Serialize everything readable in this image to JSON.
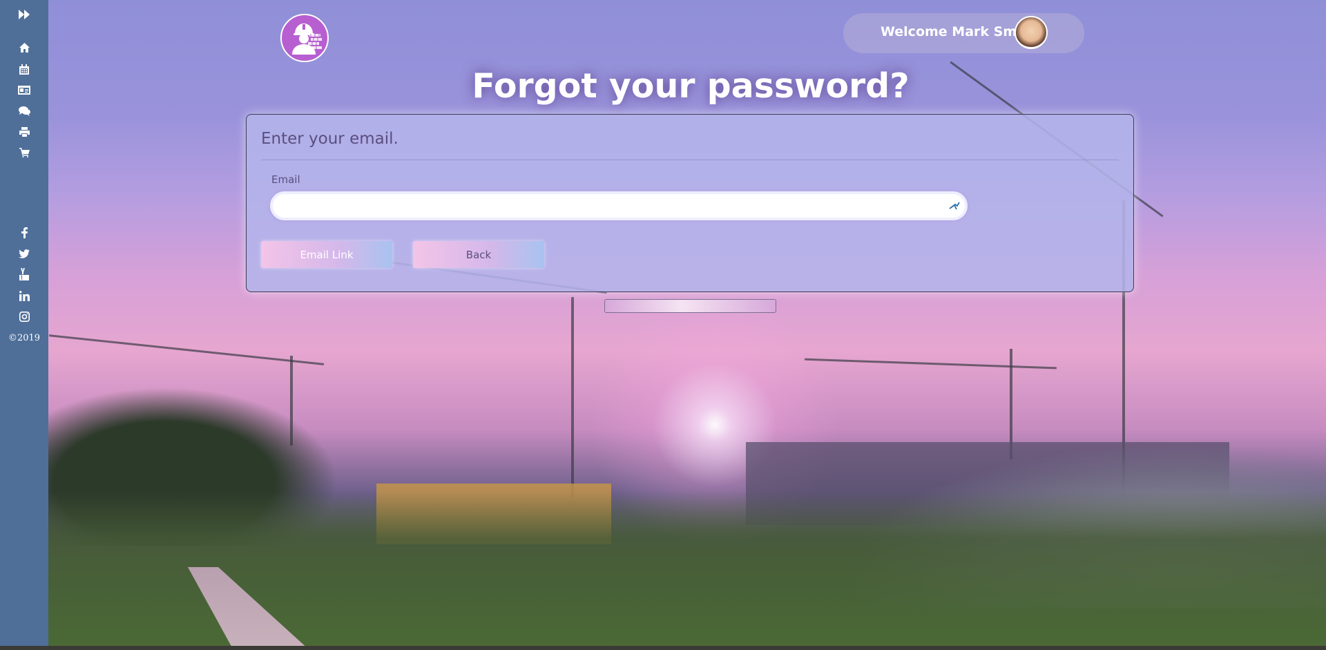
{
  "sidebar": {
    "items": [
      {
        "icon": "fast-forward-icon",
        "name": "expand"
      },
      {
        "icon": "home-icon",
        "name": "home"
      },
      {
        "icon": "calendar-icon",
        "name": "calendar"
      },
      {
        "icon": "id-card-icon",
        "name": "id-card"
      },
      {
        "icon": "comments-icon",
        "name": "chat"
      },
      {
        "icon": "print-icon",
        "name": "print"
      },
      {
        "icon": "cart-icon",
        "name": "cart"
      }
    ],
    "social": [
      {
        "icon": "facebook-icon"
      },
      {
        "icon": "twitter-icon"
      },
      {
        "icon": "youtube-icon"
      },
      {
        "icon": "linkedin-icon"
      },
      {
        "icon": "instagram-icon"
      }
    ],
    "copyright": "©2019"
  },
  "header": {
    "logo_icon": "construction-worker-icon",
    "welcome": "Welcome Mark Smith"
  },
  "page": {
    "title": "Forgot your password?"
  },
  "form": {
    "heading": "Enter your email.",
    "email_label": "Email",
    "email_value": "",
    "email_placeholder": "",
    "email_link_label": "Email Link",
    "back_label": "Back"
  },
  "colors": {
    "sidebar": "#4f6f99",
    "logo": "#b75fd0",
    "panel": "#b4b4eb",
    "text": "#5a4f7e"
  }
}
